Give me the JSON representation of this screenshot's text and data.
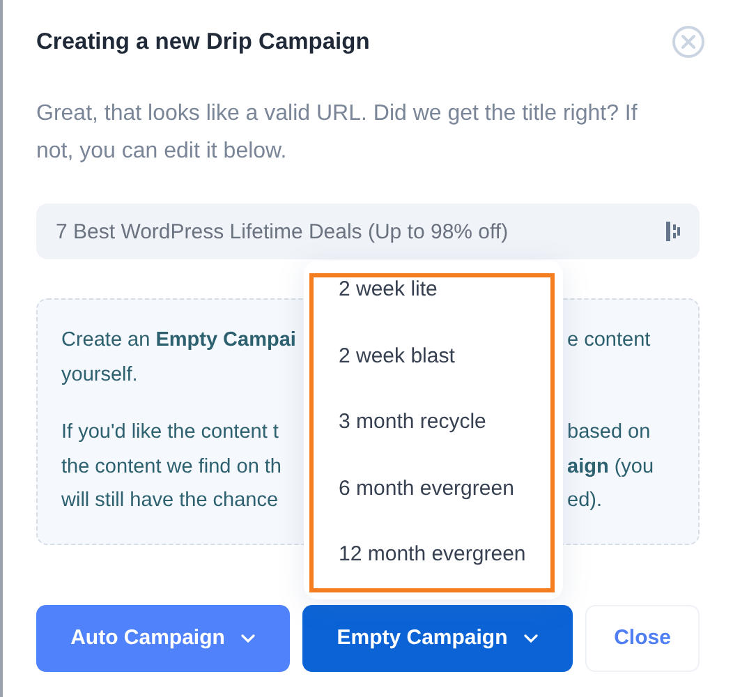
{
  "dialog": {
    "title": "Creating a new Drip Campaign",
    "description": "Great, that looks like a valid URL. Did we get the title right? If not, you can edit it below."
  },
  "title_field": {
    "value": "7 Best WordPress Lifetime Deals (Up to 98% off)"
  },
  "info_box": {
    "paragraphs": [
      {
        "lines": [
          {
            "left": "Create an **Empty Campai**",
            "right": "e content"
          },
          {
            "left": "yourself."
          }
        ]
      },
      {
        "lines": [
          {
            "left": "If you'd like the content t",
            "right": "based on"
          },
          {
            "left": "the content we find on th",
            "right": "**aign** (you"
          },
          {
            "left": "will still have the chance",
            "right": "ed)."
          }
        ]
      }
    ]
  },
  "dropdown": {
    "items": [
      {
        "label": "2 week lite"
      },
      {
        "label": "2 week blast"
      },
      {
        "label": "3 month recycle"
      },
      {
        "label": "6 month evergreen"
      },
      {
        "label": "12 month evergreen"
      }
    ]
  },
  "buttons": [
    {
      "label": "Auto Campaign",
      "kind": "primary-light"
    },
    {
      "label": "Empty Campaign",
      "kind": "primary"
    },
    {
      "label": "Close",
      "kind": "plain"
    }
  ]
}
